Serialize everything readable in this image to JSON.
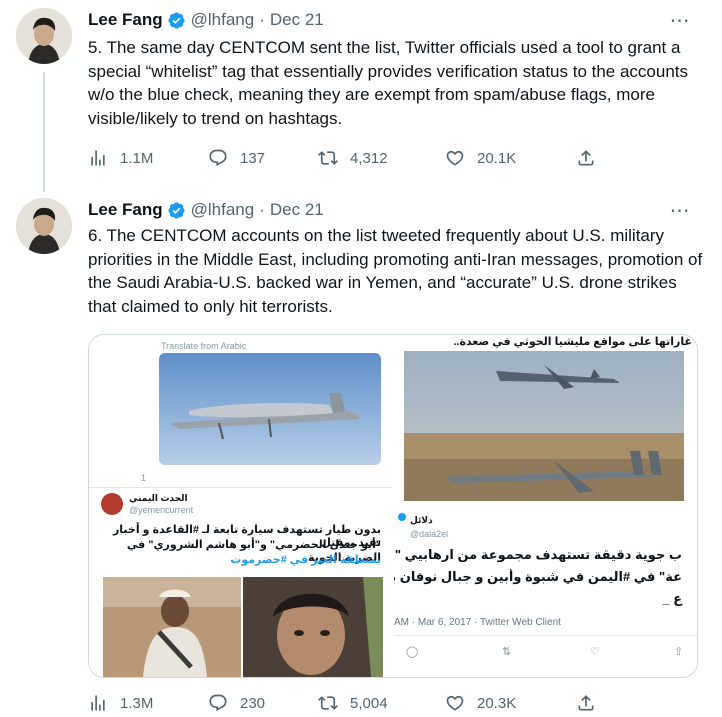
{
  "tweets": [
    {
      "name": "Lee Fang",
      "handle": "@lhfang",
      "separator": "·",
      "date": "Dec 21",
      "text": "5. The same day CENTCOM sent the list, Twitter officials used a tool to grant a special “whitelist” tag that essentially provides verification status to the accounts w/o the blue check, meaning they are exempt from spam/abuse flags, more visible/likely to trend on hashtags.",
      "views": "1.1M",
      "replies": "137",
      "retweets": "4,312",
      "likes": "20.1K"
    },
    {
      "name": "Lee Fang",
      "handle": "@lhfang",
      "separator": "·",
      "date": "Dec 21",
      "text": "6. The CENTCOM accounts on the list tweeted frequently about U.S. military priorities in the Middle East, including promoting anti-Iran messages, promotion of the Saudi Arabia-U.S. backed war in Yemen, and “accurate” U.S. drone strikes that claimed to only hit terrorists.",
      "views": "1.3M",
      "replies": "230",
      "retweets": "5,004",
      "likes": "20.3K"
    }
  ],
  "media": {
    "left": {
      "translate_label": "Translate from Arabic",
      "reply_count": "1",
      "author_name": "الحدث اليمني",
      "author_handle": "@yemencurrent",
      "line1": "بدون طيار تستهدف سيارة  تابعة لـ #القاعدة و أخبار تفيد بمقتل",
      "line2": "\"أبو جندل الحضرمي\" و\"أبو هاشم الشروري\" في الضربة الجوية",
      "line3": "بمنطقة العبر في #حضرموت"
    },
    "right": {
      "caption_top": "غاراتها على مواقع مليشيا الحوثي في صعدة..",
      "author_name": "دلائل",
      "author_handle": "@dala2el",
      "line1": "ب جوية دقيقة تستهدف مجموعة من ارهابيي \"أنصار",
      "line2": "عة\" في #اليمن  في شبوة وأبين و جبال نوفان  بمحافظة",
      "line3": "ع _",
      "meta": "AM · Mar 6, 2017 · Twitter Web Client"
    }
  },
  "colors": {
    "text": "#0f1419",
    "secondary": "#536471",
    "verified": "#1d9bf0",
    "border": "#cfd9de",
    "link": "#1d9bf0"
  },
  "icons": [
    "verified-badge-icon",
    "more-icon",
    "views-icon",
    "reply-icon",
    "retweet-icon",
    "like-icon",
    "share-icon"
  ]
}
